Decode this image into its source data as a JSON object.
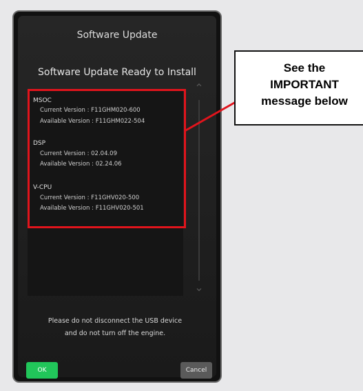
{
  "dialog": {
    "title": "Software Update",
    "subtitle": "Software Update Ready to Install",
    "sections": [
      {
        "name": "MSOC",
        "current_label": "Current Version   : F11GHM020-600",
        "available_label": "Available Version : F11GHM022-504"
      },
      {
        "name": "DSP",
        "current_label": "Current Version   : 02.04.09",
        "available_label": "Available Version : 02.24.06"
      },
      {
        "name": "V-CPU",
        "current_label": "Current Version   : F11GHV020-500",
        "available_label": "Available Version : F11GHV020-501"
      }
    ],
    "notice_line1": "Please do not disconnect the USB device",
    "notice_line2": "and do not turn off the engine.",
    "ok_label": "OK",
    "cancel_label": "Cancel"
  },
  "callout": {
    "line1": "See the",
    "line2": "IMPORTANT",
    "line3": "message below"
  },
  "colors": {
    "highlight": "#e1141c",
    "ok_button": "#21c65a",
    "cancel_button": "#5a5a5a"
  }
}
